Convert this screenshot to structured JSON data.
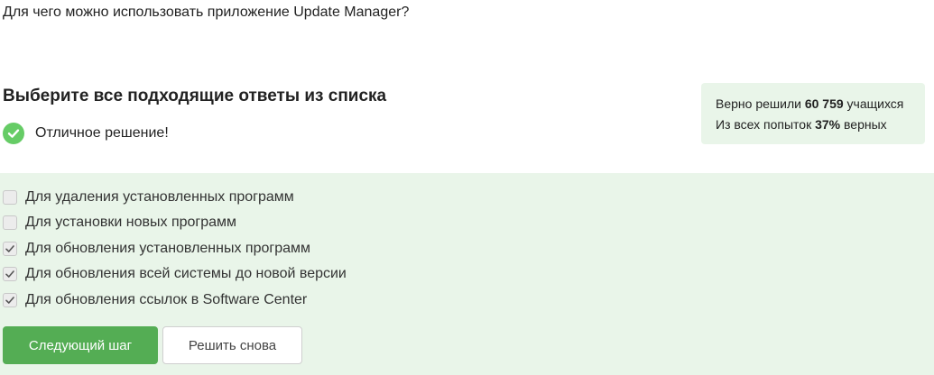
{
  "question": "Для чего можно использовать приложение Update Manager?",
  "instruction": "Выберите все подходящие ответы из списка",
  "result": {
    "icon": "check-circle-icon",
    "text": "Отличное решение!",
    "color": "#66cc66"
  },
  "stats": {
    "solved_prefix": "Верно решили ",
    "solved_count": "60 759",
    "solved_suffix": " учащихся",
    "attempts_prefix": "Из всех попыток ",
    "attempts_percent": "37%",
    "attempts_suffix": " верных"
  },
  "options": [
    {
      "label": "Для удаления установленных программ",
      "checked": false
    },
    {
      "label": "Для установки новых программ",
      "checked": false
    },
    {
      "label": "Для обновления установленных программ",
      "checked": true
    },
    {
      "label": "Для обновления всей системы до новой версии",
      "checked": true
    },
    {
      "label": "Для обновления ссылок в Software Center",
      "checked": true
    }
  ],
  "buttons": {
    "next": "Следующий шаг",
    "retry": "Решить снова"
  },
  "colors": {
    "accent": "#54ad54",
    "panel": "#e9f5e9"
  }
}
